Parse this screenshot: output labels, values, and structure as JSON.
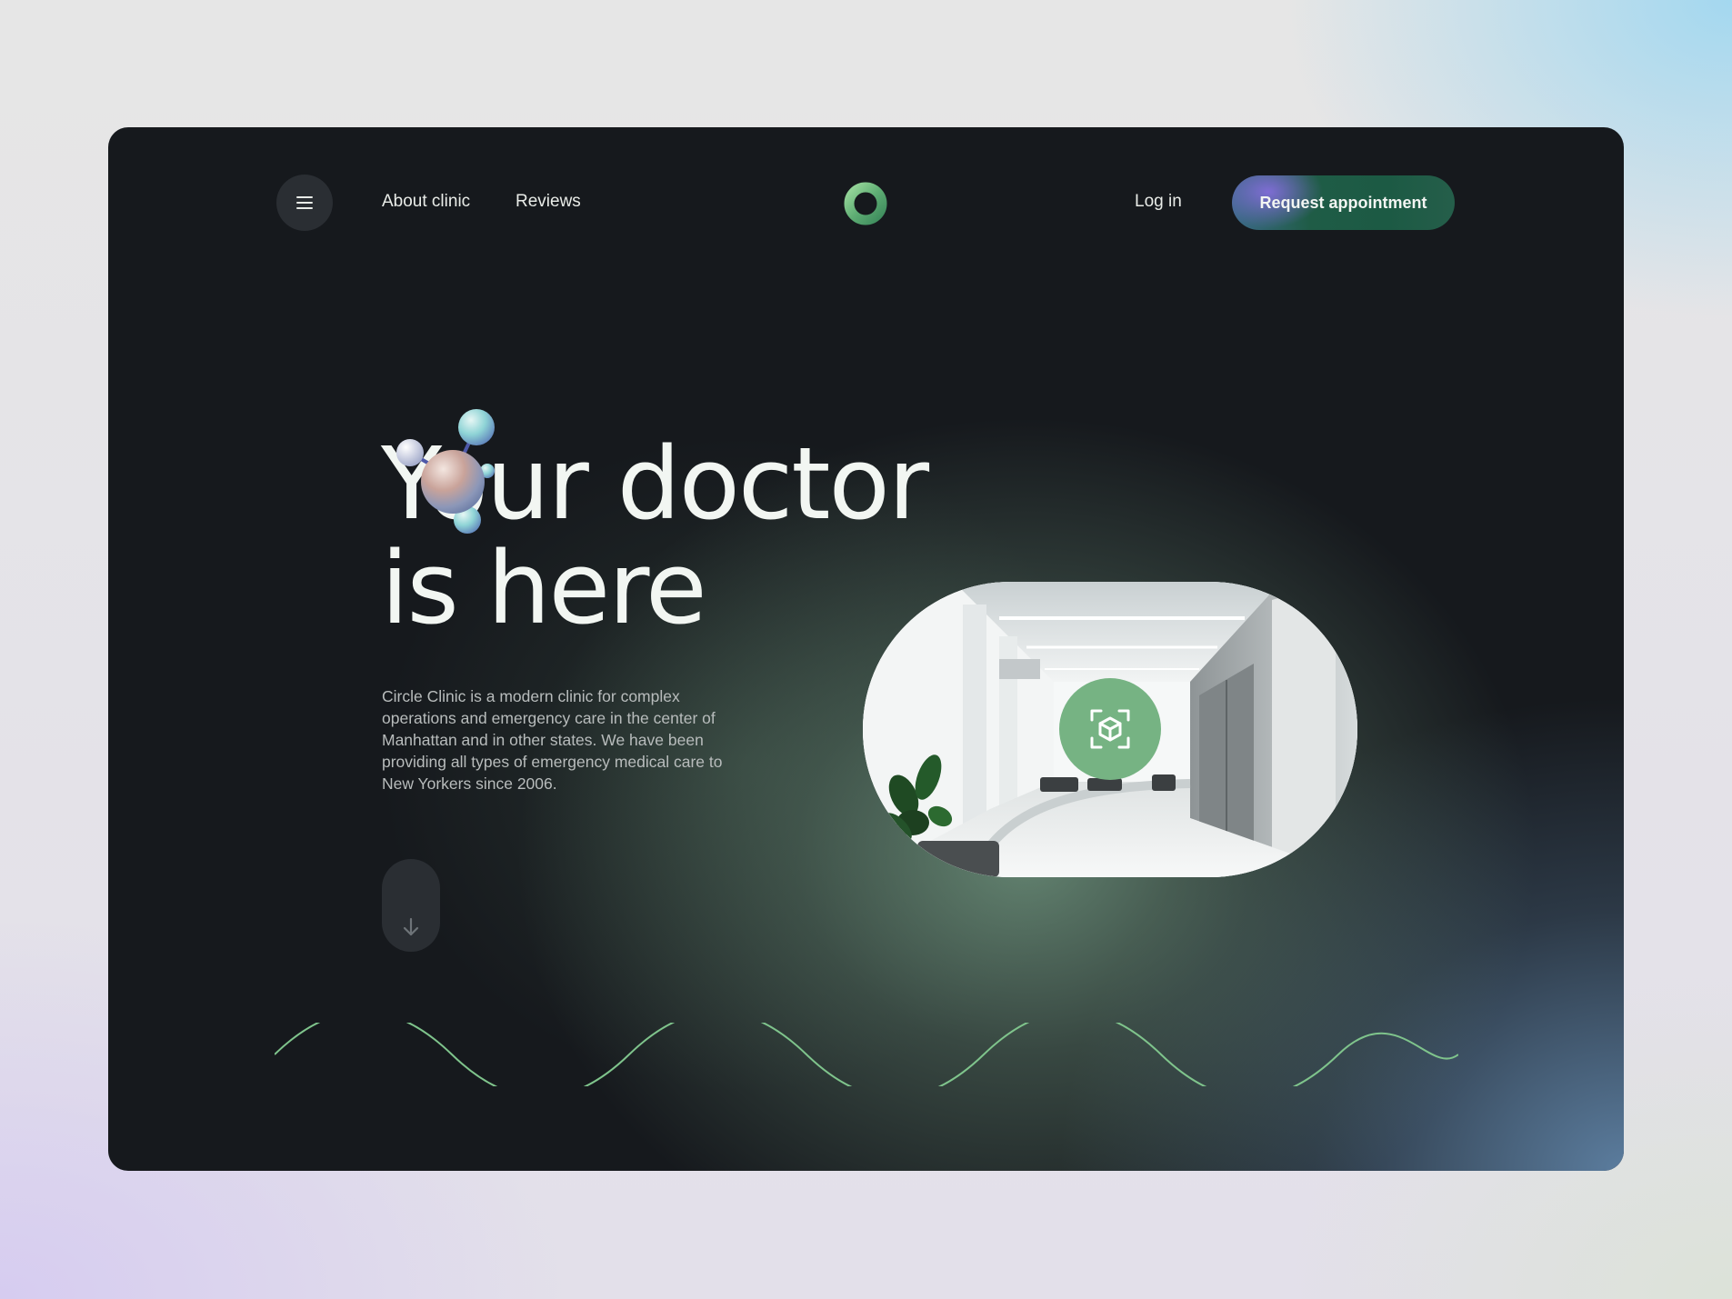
{
  "nav": {
    "about_label": "About clinic",
    "reviews_label": "Reviews",
    "login_label": "Log in",
    "cta_label": "Request appointment"
  },
  "hero": {
    "title_line1": "Your doctor",
    "title_line2": "is here",
    "description": "Circle Clinic is a modern clinic for complex operations and emergency care in the center of Manhattan and in other states. We have been providing all types of emergency medical care to New Yorkers since 2006."
  },
  "icons": {
    "menu": "menu-icon",
    "logo": "ring-logo",
    "scroll": "arrow-down-icon",
    "ar": "3d-box-scan-icon"
  },
  "colors": {
    "card_background": "#16191d",
    "accent_green": "#76b383",
    "cta_green": "#1f5c46",
    "wave_green": "#7fc48c"
  }
}
